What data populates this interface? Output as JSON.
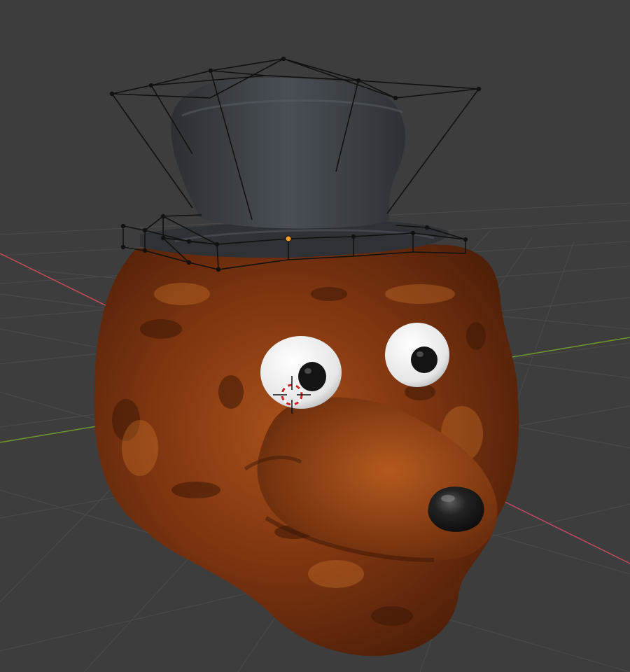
{
  "viewport": {
    "background": "#3d3d3d",
    "grid_color": "#4a4a4a",
    "x_axis_color": "#c24a5a",
    "y_axis_color": "#6c9a2c"
  },
  "scene_objects": {
    "head": {
      "name": "bear-head",
      "material_color": "#8a3a12"
    },
    "hat": {
      "name": "top-hat",
      "material_color": "#3b3f44"
    },
    "eyes": {
      "name": "eyes",
      "color": "#f2f2f2",
      "pupil_color": "#1a1a1a"
    },
    "nose": {
      "name": "nose",
      "color": "#1c1c1c"
    },
    "lattice": {
      "name": "lattice-cage",
      "color": "#111111",
      "active_vertex_color": "#ffa228"
    },
    "cursor_3d": {
      "name": "3d-cursor",
      "colors": [
        "#cc2222",
        "#ffffff"
      ]
    }
  }
}
